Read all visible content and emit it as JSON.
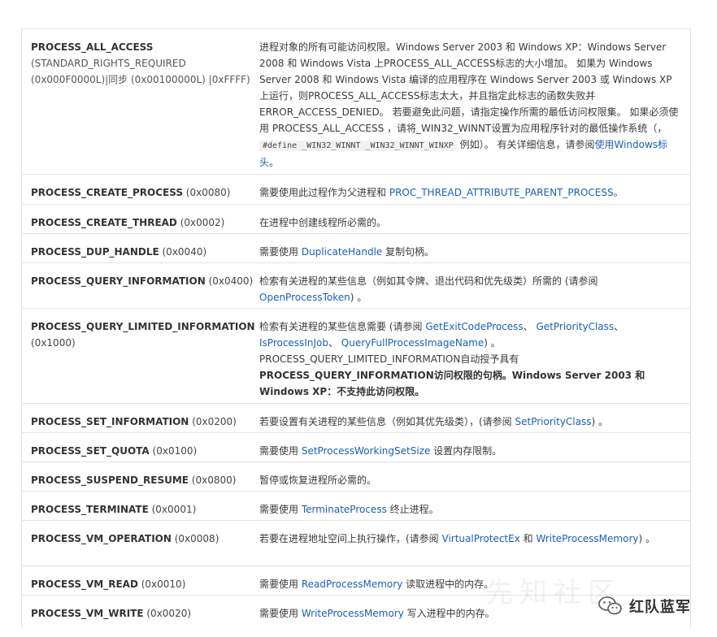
{
  "rows": [
    {
      "name": "PROCESS_ALL_ACCESS",
      "value": "(STANDARD_RIGHTS_REQUIRED (0x000F0000L)|同步 (0x00100000L) |0xFFFF)",
      "desc": {
        "intro": "进程对象的所有可能访问权限。Windows Server 2003 和 Windows XP：Windows Server 2008 和 Windows Vista 上PROCESS_ALL_ACCESS标志的大小增加。 如果为 Windows Server 2008 和 Windows Vista 编译的应用程序在 Windows Server 2003 或 Windows XP 上运行，则PROCESS_ALL_ACCESS标志太大，并且指定此标志的函数失败并ERROR_ACCESS_DENIED。 若要避免此问题，请指定操作所需的最低访问权限集。 如果必须使用 PROCESS_ALL_ACCESS ，请将_WIN32_WINNT设置为应用程序针对的最低操作系统（，",
        "code": "#define _WIN32_WINNT _WIN32_WINNT_WINXP",
        "after": "例如）。 有关详细信息，请参阅",
        "link": "使用Windows标头",
        "end": "。"
      }
    },
    {
      "name": "PROCESS_CREATE_PROCESS",
      "value": "(0x0080)",
      "desc": {
        "pre": "需要使用此过程作为父进程和 ",
        "link": "PROC_THREAD_ATTRIBUTE_PARENT_PROCESS",
        "post": "。"
      }
    },
    {
      "name": "PROCESS_CREATE_THREAD",
      "value": "(0x0002)",
      "desc": {
        "text": "在进程中创建线程所必需的。"
      }
    },
    {
      "name": "PROCESS_DUP_HANDLE",
      "value": "(0x0040)",
      "desc": {
        "pre": "需要使用 ",
        "link": "DuplicateHandle",
        "post": " 复制句柄。"
      }
    },
    {
      "name": "PROCESS_QUERY_INFORMATION",
      "value": "(0x0400)",
      "desc": {
        "pre": "检索有关进程的某些信息（例如其令牌、退出代码和优先级类）所需的 (请参阅 ",
        "link": "OpenProcessToken",
        "post": ") 。"
      }
    },
    {
      "name": "PROCESS_QUERY_LIMITED_INFORMATION",
      "value": "(0x1000)",
      "desc": {
        "pre": "检索有关进程的某些信息需要 (请参阅 ",
        "link1": "GetExitCodeProcess",
        "sep1": "、 ",
        "link2": "GetPriorityClass",
        "sep2": "、",
        "link3": "IsProcessInJob",
        "sep3": "、 ",
        "link4": "QueryFullProcessImageName",
        "post": ") 。",
        "line2": "PROCESS_QUERY_LIMITED_INFORMATION自动授予具有",
        "line3": "PROCESS_QUERY_INFORMATION访问权限的句柄。Windows Server 2003 和 Windows XP：不支持此访问权限。"
      }
    },
    {
      "name": "PROCESS_SET_INFORMATION",
      "value": "(0x0200)",
      "desc": {
        "pre": "若要设置有关进程的某些信息（例如其优先级类），(请参阅 ",
        "link": "SetPriorityClass",
        "post": ") 。"
      }
    },
    {
      "name": "PROCESS_SET_QUOTA",
      "value": "(0x0100)",
      "desc": {
        "pre": "需要使用 ",
        "link": "SetProcessWorkingSetSize",
        "post": " 设置内存限制。"
      }
    },
    {
      "name": "PROCESS_SUSPEND_RESUME",
      "value": "(0x0800)",
      "desc": {
        "text": "暂停或恢复进程所必需的。"
      }
    },
    {
      "name": "PROCESS_TERMINATE",
      "value": "(0x0001)",
      "desc": {
        "pre": "需要使用 ",
        "link": "TerminateProcess",
        "post": " 终止进程。"
      }
    },
    {
      "name": "PROCESS_VM_OPERATION",
      "value": "(0x0008)",
      "desc": {
        "pre": "若要在进程地址空间上执行操作，(请参阅 ",
        "link1": "VirtualProtectEx",
        "mid": " 和 ",
        "link2": "WriteProcessMemory",
        "post": ") 。"
      }
    },
    {
      "name": "PROCESS_VM_READ",
      "value": "(0x0010)",
      "desc": {
        "pre": "需要使用 ",
        "link": "ReadProcessMemory",
        "post": " 读取进程中的内存。"
      }
    },
    {
      "name": "PROCESS_VM_WRITE",
      "value": "(0x0020)",
      "desc": {
        "pre": "需要使用 ",
        "link": "WriteProcessMemory",
        "post": " 写入进程中的内存。"
      }
    }
  ],
  "watermark": "先知社区",
  "brand": "红队蓝军"
}
